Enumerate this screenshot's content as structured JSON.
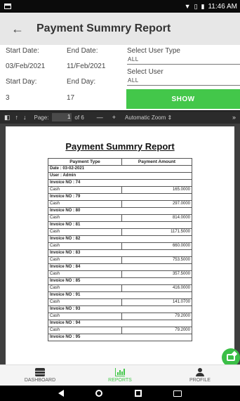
{
  "status_bar": {
    "time": "11:46 AM"
  },
  "app_bar": {
    "title": "Payment Summry Report"
  },
  "filters": {
    "start_date_label": "Start Date:",
    "start_date_value": "03/Feb/2021",
    "end_date_label": "End Date:",
    "end_date_value": "11/Feb/2021",
    "start_day_label": "Start Day:",
    "start_day_value": "3",
    "end_day_label": "End Day:",
    "end_day_value": "17",
    "user_type_label": "Select User Type",
    "user_type_value": "ALL",
    "user_label": "Select User",
    "user_value": "ALL",
    "show_label": "SHOW"
  },
  "pdf_toolbar": {
    "page_label": "Page:",
    "page_current": "1",
    "page_total": "of 6",
    "zoom": "Automatic Zoom"
  },
  "report": {
    "title": "Payment Summry Report",
    "col_type": "Payment Type",
    "col_amount": "Payment Amount",
    "date_line": "Date : 03-02-2021",
    "user_line": "User : Admin",
    "invoices": [
      {
        "label": "Invoice NO : 74",
        "type": "Cash",
        "amount": "165.0000"
      },
      {
        "label": "Invoice NO : 79",
        "type": "Cash",
        "amount": "297.0000"
      },
      {
        "label": "Invoice NO : 80",
        "type": "Cash",
        "amount": "814.0000"
      },
      {
        "label": "Invoice NO : 81",
        "type": "Cash",
        "amount": "1171.5000"
      },
      {
        "label": "Invoice NO : 82",
        "type": "Cash",
        "amount": "660.0000"
      },
      {
        "label": "Invoice NO : 83",
        "type": "Cash",
        "amount": "753.5000"
      },
      {
        "label": "Invoice NO : 84",
        "type": "Cash",
        "amount": "357.5000"
      },
      {
        "label": "Invoice NO : 85",
        "type": "Cash",
        "amount": "416.0000"
      },
      {
        "label": "Invoice NO : 91",
        "type": "Cash",
        "amount": "141.0700"
      },
      {
        "label": "Invoice NO : 93",
        "type": "Cash",
        "amount": "79.2000"
      },
      {
        "label": "Invoice NO : 94",
        "type": "Cash",
        "amount": "79.2000"
      },
      {
        "label": "Invoice NO : 95",
        "type": "",
        "amount": ""
      }
    ]
  },
  "bottom_nav": {
    "dashboard": "DASHBOARD",
    "reports": "REPORTS",
    "profile": "PROFILE"
  },
  "colors": {
    "accent": "#43c74a"
  }
}
